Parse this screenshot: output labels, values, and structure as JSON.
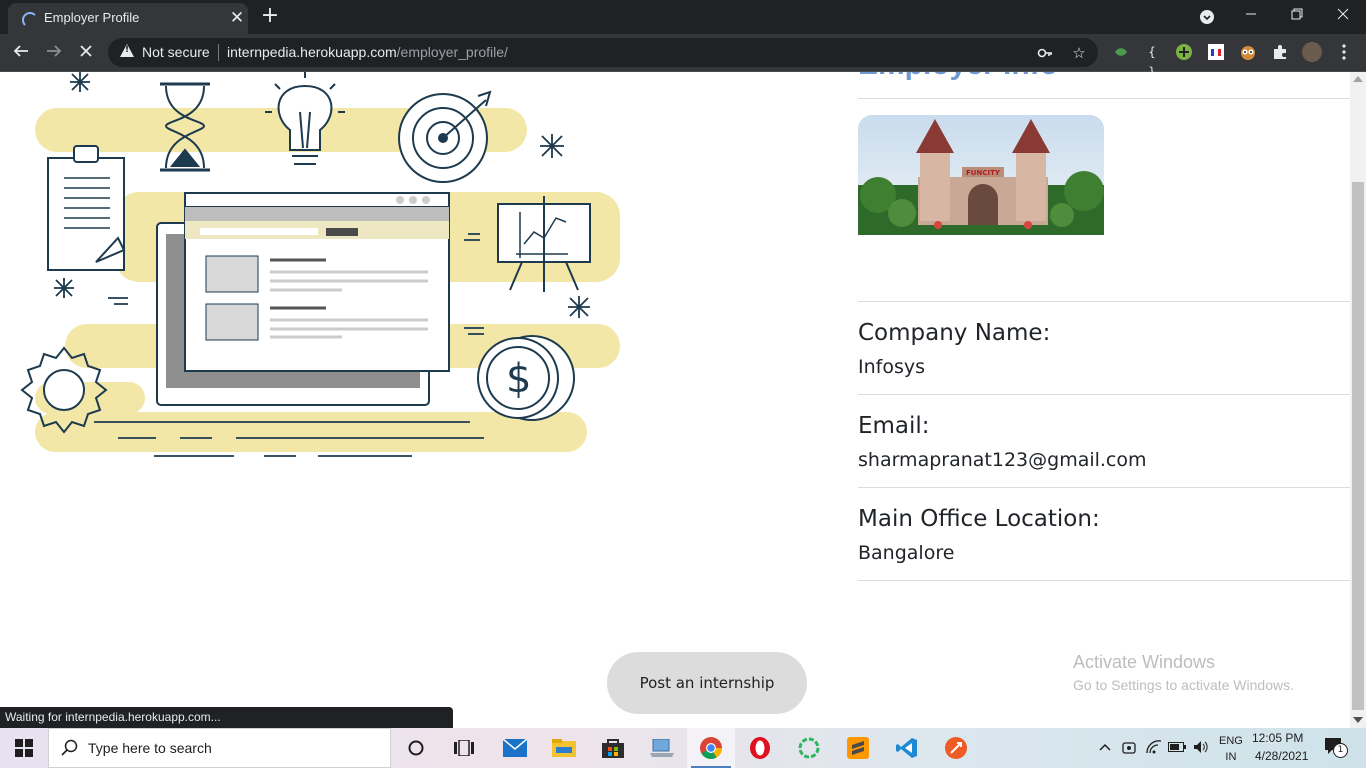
{
  "browser": {
    "tab_title": "Employer Profile",
    "new_tab_symbol": "+",
    "url_security": "Not secure",
    "url_host": "internpedia.herokuapp.com",
    "url_path": "/employer_profile/",
    "status_text": "Waiting for internpedia.herokuapp.com..."
  },
  "page": {
    "section_heading": "Employer Info",
    "fields": [
      {
        "label": "Company Name:",
        "value": "Infosys"
      },
      {
        "label": "Email:",
        "value": "sharmapranat123@gmail.com"
      },
      {
        "label": "Main Office Location:",
        "value": "Bangalore"
      }
    ],
    "photo_sign_text": "FUNCITY",
    "post_button_label": "Post an internship"
  },
  "watermark": {
    "title": "Activate Windows",
    "subtitle": "Go to Settings to activate Windows."
  },
  "taskbar": {
    "search_placeholder": "Type here to search",
    "lang_top": "ENG",
    "lang_bottom": "IN",
    "time": "12:05 PM",
    "date": "4/28/2021",
    "notification_count": "1",
    "apps": [
      "cortana-icon",
      "task-view-icon",
      "mail-icon",
      "file-explorer-icon",
      "store-icon",
      "laptop-app-icon",
      "chrome-icon",
      "opera-icon",
      "green-ring-app-icon",
      "sublime-text-icon",
      "vscode-icon",
      "postman-icon"
    ]
  },
  "colors": {
    "heading_blue": "#6f9bd2",
    "illustration_yellow": "#f3e7a8",
    "illustration_navy": "#1d3a4f",
    "chrome_dark": "#202124"
  }
}
